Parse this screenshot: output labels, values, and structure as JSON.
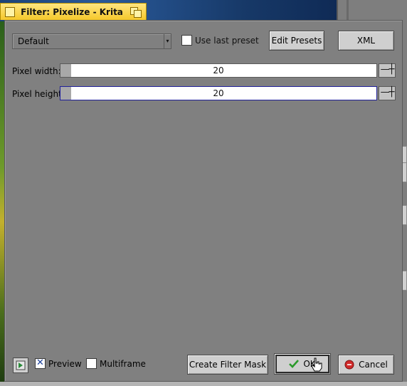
{
  "window": {
    "title": "Filter: Pixelize - Krita"
  },
  "preset": {
    "selected": "Default",
    "use_last_label": "Use last preset",
    "use_last_checked": false,
    "edit_presets_label": "Edit Presets",
    "xml_label": "XML"
  },
  "params": [
    {
      "label": "Pixel width:",
      "value": "20"
    },
    {
      "label": "Pixel height:",
      "value": "20"
    }
  ],
  "chain_glyph": "—┼",
  "footer": {
    "preview_label": "Preview",
    "preview_checked": true,
    "multiframe_label": "Multiframe",
    "multiframe_checked": false,
    "create_mask_label": "Create Filter Mask",
    "ok_label": "OK",
    "cancel_label": "Cancel"
  },
  "colors": {
    "dialog_bg": "#808080",
    "title_bg": "#f5c82a",
    "ok_icon": "#2a9a2a",
    "cancel_icon": "#d02a2a"
  },
  "icons": {
    "ok": "checkmark-icon",
    "cancel": "cancel-icon",
    "preview_toggle": "preview-toggle-icon"
  }
}
